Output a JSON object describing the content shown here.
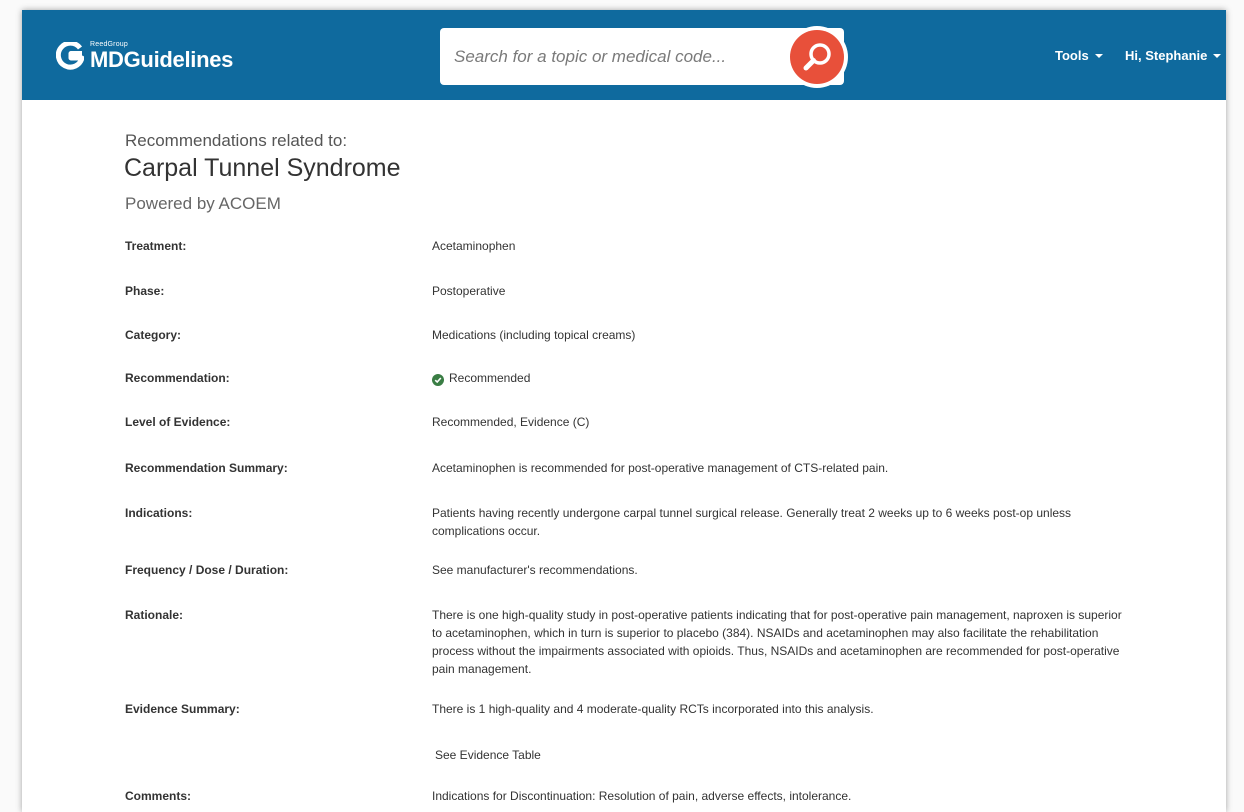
{
  "header": {
    "logo_small": "ReedGroup",
    "logo_big": "MDGuidelines",
    "search_placeholder": "Search for a topic or medical code...",
    "tools_label": "Tools",
    "user_label": "Hi, Stephanie",
    "bg_color": "#0f6a9e",
    "search_button_color": "#e8503a"
  },
  "page": {
    "related_label": "Recommendations related to:",
    "title": "Carpal Tunnel Syndrome",
    "powered_by": "Powered by ACOEM"
  },
  "details": {
    "treatment": {
      "label": "Treatment:",
      "value": "Acetaminophen"
    },
    "phase": {
      "label": "Phase:",
      "value": "Postoperative"
    },
    "category": {
      "label": "Category:",
      "value": "Medications (including topical creams)"
    },
    "recommendation": {
      "label": "Recommendation:",
      "value": "Recommended",
      "icon": "check-circle-icon",
      "icon_color": "#3a7d44"
    },
    "level": {
      "label": "Level of Evidence:",
      "value": "Recommended, Evidence (C)"
    },
    "summary": {
      "label": "Recommendation Summary:",
      "value": "Acetaminophen is recommended for post-operative management of CTS-related pain."
    },
    "indications": {
      "label": "Indications:",
      "value": "Patients having recently undergone carpal tunnel surgical release. Generally treat 2 weeks up to 6 weeks post-op unless complications occur."
    },
    "frequency": {
      "label": "Frequency / Dose / Duration:",
      "value": "See manufacturer's recommendations."
    },
    "rationale": {
      "label": "Rationale:",
      "value": "There is one high-quality study in post-operative patients indicating that for post-operative pain management, naproxen is superior to acetaminophen, which in turn is superior to placebo (384). NSAIDs and acetaminophen may also facilitate the rehabilitation process without the impairments associated with opioids. Thus, NSAIDs and acetaminophen are recommended for post-operative pain management."
    },
    "evidence": {
      "label": "Evidence Summary:",
      "value": "There is 1 high-quality and 4 moderate-quality RCTs incorporated into this analysis.",
      "link": "See Evidence Table",
      "link_color": "#2a86c2"
    },
    "comments": {
      "label": "Comments:",
      "value": "Indications for Discontinuation: Resolution of pain, adverse effects, intolerance."
    }
  }
}
